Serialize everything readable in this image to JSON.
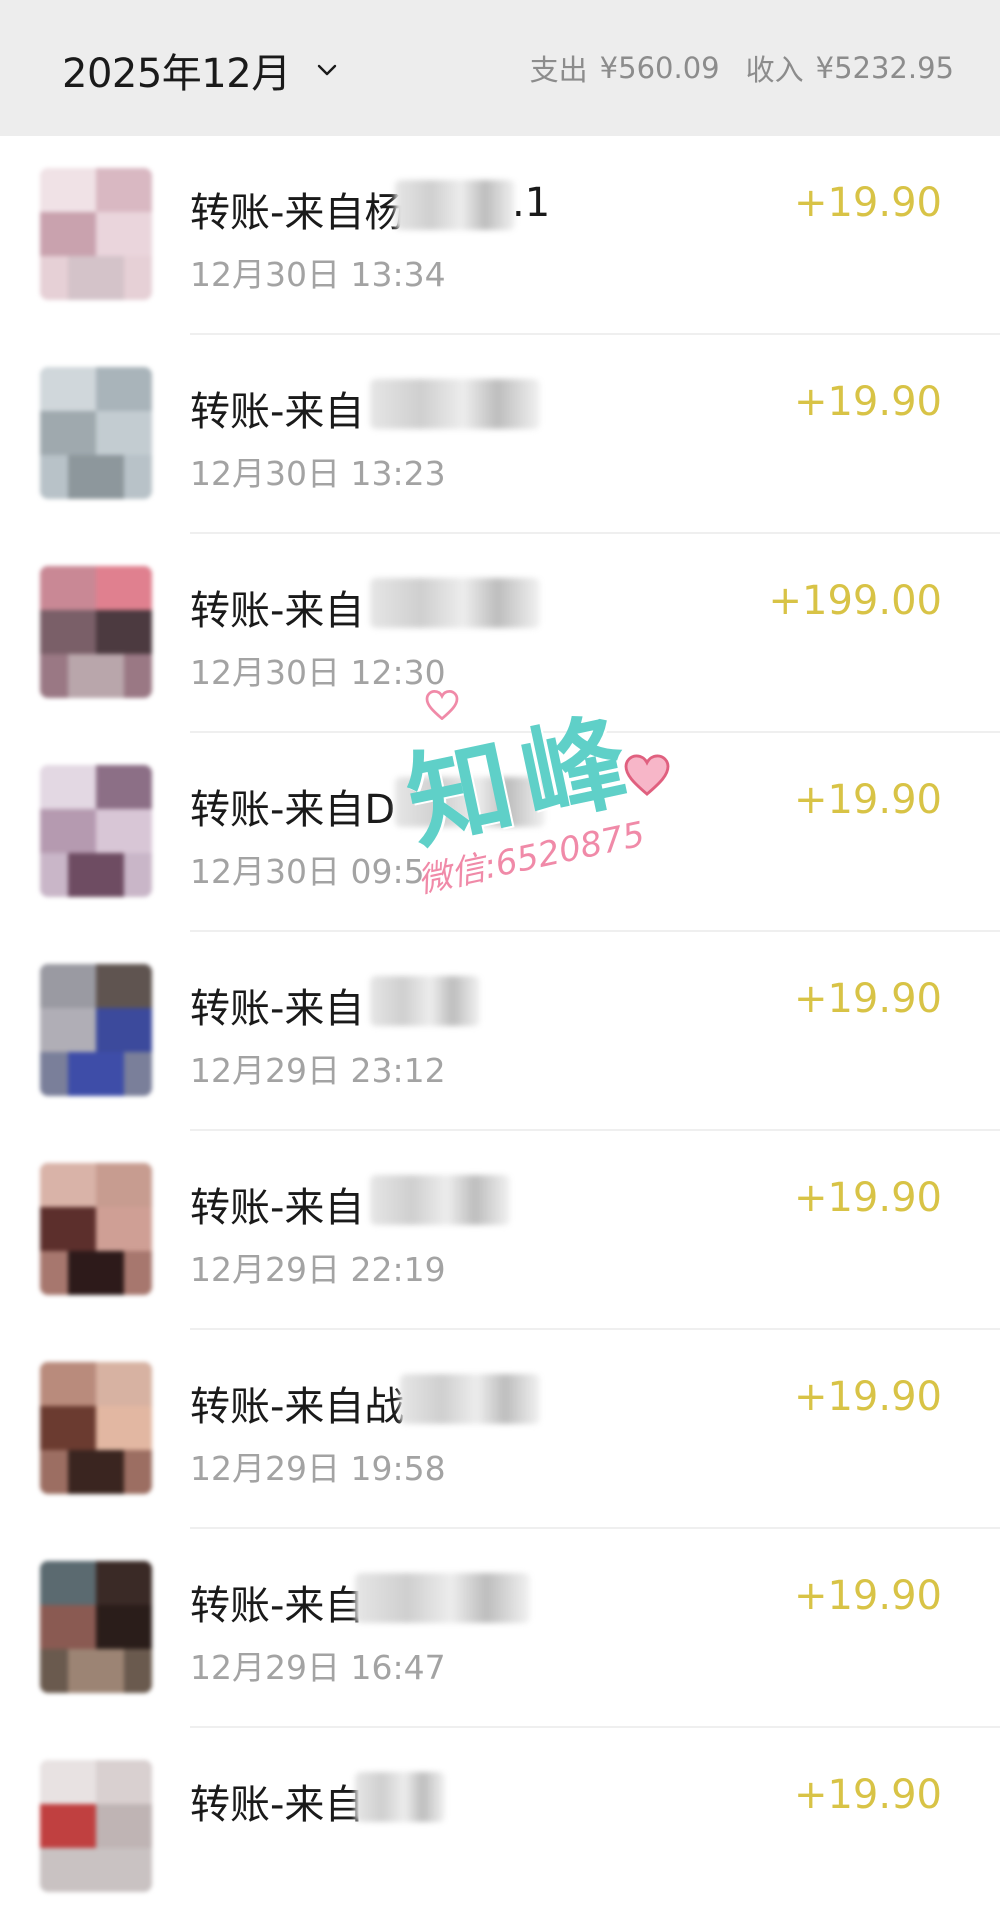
{
  "header": {
    "month": "2025年12月",
    "expense_label": "支出",
    "expense_value": "¥560.09",
    "income_label": "收入",
    "income_value": "¥5232.95"
  },
  "transactions": [
    {
      "title": "转账-来自杨",
      "title_suffix": ".1",
      "time": "12月30日 13:34",
      "amount": "+19.90"
    },
    {
      "title": "转账-来自",
      "title_suffix": "",
      "time": "12月30日 13:23",
      "amount": "+19.90"
    },
    {
      "title": "转账-来自",
      "title_suffix": "",
      "time": "12月30日 12:30",
      "amount": "+199.00"
    },
    {
      "title": "转账-来自D",
      "title_suffix": "",
      "time": "12月30日 09:5",
      "amount": "+19.90"
    },
    {
      "title": "转账-来自",
      "title_suffix": "",
      "time": "12月29日 23:12",
      "amount": "+19.90"
    },
    {
      "title": "转账-来自",
      "title_suffix": "",
      "time": "12月29日 22:19",
      "amount": "+19.90"
    },
    {
      "title": "转账-来自战",
      "title_suffix": "",
      "time": "12月29日 19:58",
      "amount": "+19.90"
    },
    {
      "title": "转账-来自",
      "title_suffix": "",
      "time": "12月29日 16:47",
      "amount": "+19.90"
    },
    {
      "title": "转账-来自",
      "title_suffix": "",
      "time": "",
      "amount": "+19.90"
    }
  ],
  "watermark": {
    "main": "知峰",
    "sub": "微信:6520875"
  },
  "colors": {
    "header_bg": "#ededed",
    "amount": "#d8c346",
    "time": "#a3a3a3",
    "watermark_main": "#5fd0c8",
    "watermark_sub": "#f08aa8"
  },
  "icons": {
    "month_dropdown": "chevron-down-icon"
  }
}
